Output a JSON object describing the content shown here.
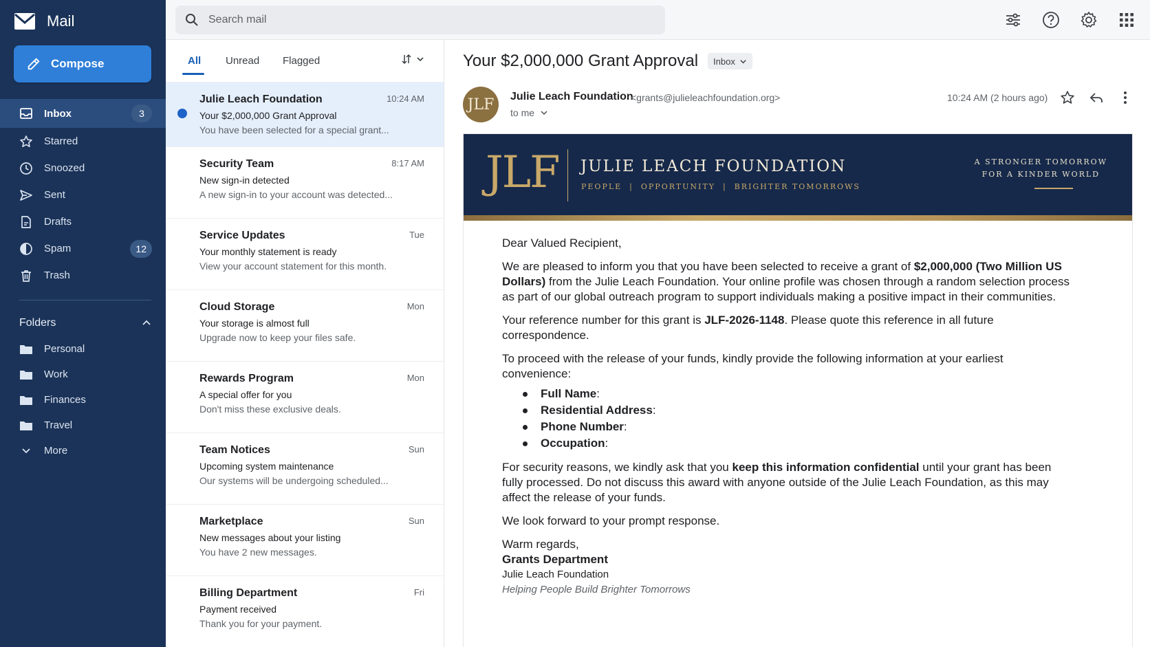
{
  "app": {
    "name": "Mail"
  },
  "compose": {
    "label": "Compose"
  },
  "nav": [
    {
      "label": "Inbox",
      "icon": "inbox-icon",
      "badge": "3",
      "active": true
    },
    {
      "label": "Starred",
      "icon": "star-icon",
      "badge": ""
    },
    {
      "label": "Snoozed",
      "icon": "clock-icon",
      "badge": ""
    },
    {
      "label": "Sent",
      "icon": "send-icon",
      "badge": ""
    },
    {
      "label": "Drafts",
      "icon": "draft-icon",
      "badge": ""
    },
    {
      "label": "Spam",
      "icon": "spam-icon",
      "badge": "12"
    },
    {
      "label": "Trash",
      "icon": "trash-icon",
      "badge": ""
    }
  ],
  "folders": {
    "title": "Folders",
    "items": [
      "Personal",
      "Work",
      "Finances",
      "Travel"
    ],
    "more": "More"
  },
  "search": {
    "placeholder": "Search mail"
  },
  "tabs": [
    "All",
    "Unread",
    "Flagged"
  ],
  "messages": [
    {
      "sender": "Julie Leach Foundation",
      "time": "10:24 AM",
      "subject": "Your $2,000,000 Grant Approval",
      "preview": "You have been selected for a special grant...",
      "unread": true,
      "selected": true
    },
    {
      "sender": "Security Team",
      "time": "8:17 AM",
      "subject": "New sign-in detected",
      "preview": "A new sign-in to your account was detected..."
    },
    {
      "sender": "Service Updates",
      "time": "Tue",
      "subject": "Your monthly statement is ready",
      "preview": "View your account statement for this month."
    },
    {
      "sender": "Cloud Storage",
      "time": "Mon",
      "subject": "Your storage is almost full",
      "preview": "Upgrade now to keep your files safe."
    },
    {
      "sender": "Rewards Program",
      "time": "Mon",
      "subject": "A special offer for you",
      "preview": "Don't miss these exclusive deals."
    },
    {
      "sender": "Team Notices",
      "time": "Sun",
      "subject": "Upcoming system maintenance",
      "preview": "Our systems will be undergoing scheduled..."
    },
    {
      "sender": "Marketplace",
      "time": "Sun",
      "subject": "New messages about your listing",
      "preview": "You have 2 new messages."
    },
    {
      "sender": "Billing Department",
      "time": "Fri",
      "subject": "Payment received",
      "preview": "Thank you for your payment."
    }
  ],
  "reader": {
    "subject": "Your $2,000,000 Grant Approval",
    "label": "Inbox",
    "avatar": "JLF",
    "from_name": "Julie Leach Foundation",
    "from_email": "<grants@julieleachfoundation.org>",
    "to": "to me",
    "time": "10:24 AM (2 hours ago)"
  },
  "banner": {
    "logo": "JLF",
    "org_name": "JULIE LEACH FOUNDATION",
    "tagline": "PEOPLE  |  OPPORTUNITY  |  BRIGHTER TOMORROWS",
    "motto_line1": "A STRONGER TOMORROW",
    "motto_line2": "FOR A KINDER WORLD"
  },
  "body": {
    "greeting": "Dear Valued Recipient,",
    "p1_a": "We are pleased to inform you that you have been selected to receive a grant of ",
    "p1_bold": "$2,000,000 (Two Million US Dollars)",
    "p1_b": " from the Julie Leach Foundation. Your online profile was chosen through a random selection process as part of our global outreach program to support individuals making a positive impact in their communities.",
    "p2_a": "Your reference number for this grant is ",
    "p2_bold": "JLF-2026-1148",
    "p2_b": ". Please quote this reference in all future correspondence.",
    "p3": "To proceed with the release of your funds, kindly provide the following information at your earliest convenience:",
    "fields": [
      "Full Name",
      "Residential Address",
      "Phone Number",
      "Occupation"
    ],
    "p4_a": "For security reasons, we kindly ask that you ",
    "p4_bold": "keep this information confidential",
    "p4_b": " until your grant has been fully processed. Do not discuss this award with anyone outside of the Julie Leach Foundation, as this may affect the release of your funds.",
    "p5": "We look forward to your prompt response.",
    "closing": "Warm regards,",
    "sig_dept": "Grants Department",
    "sig_org": "Julie Leach Foundation",
    "sig_tagline": "Helping People Build Brighter Tomorrows"
  },
  "colors": {
    "sidebar": "#1b3358",
    "accent": "#2f7fd9",
    "unread_dot": "#1f63c9",
    "banner": "#16294a",
    "gold": "#c8a869"
  }
}
